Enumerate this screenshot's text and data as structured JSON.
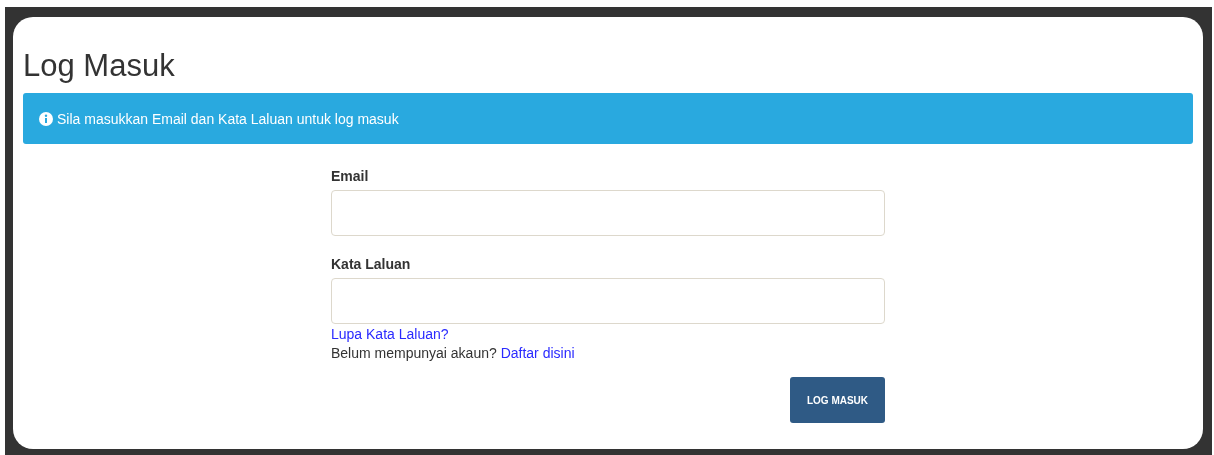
{
  "title": "Log Masuk",
  "alert": {
    "text": "Sila masukkan Email dan Kata Laluan untuk log masuk"
  },
  "fields": [
    {
      "label": "Email"
    },
    {
      "label": "Kata Laluan"
    }
  ],
  "forgot_link": "Lupa Kata Laluan?",
  "register": {
    "text": "Belum mempunyai akaun?",
    "link": "Daftar disini"
  },
  "submit_button": "LOG MASUK"
}
